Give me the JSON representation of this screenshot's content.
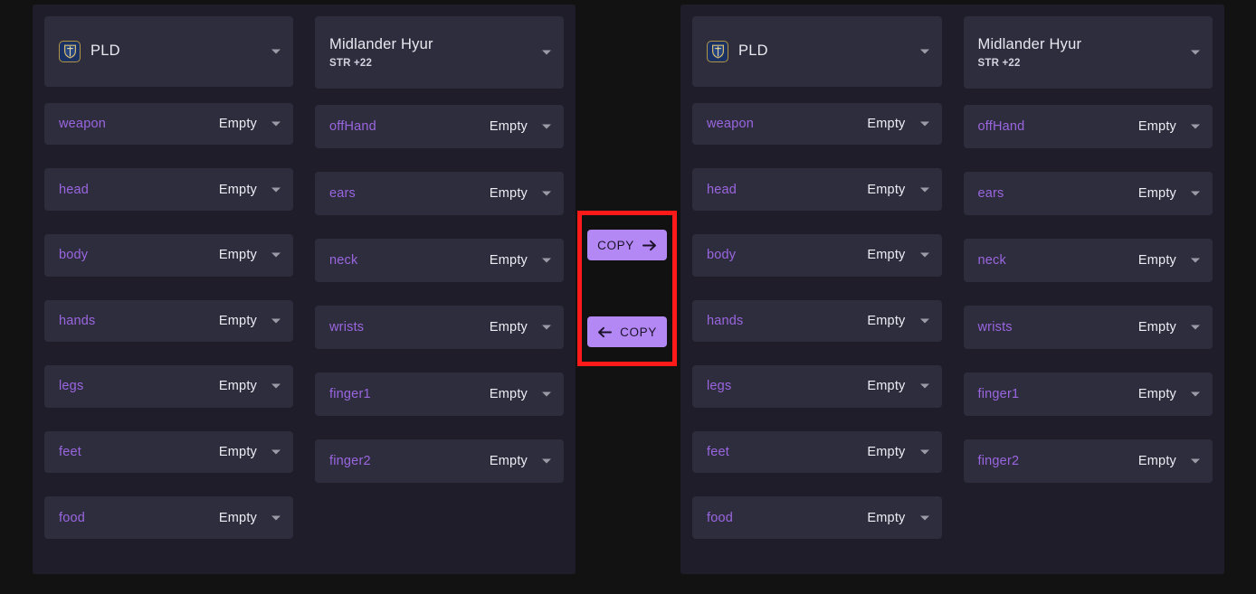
{
  "colors": {
    "background": "#121212",
    "panel": "#1e1d29",
    "card": "#2e2d3d",
    "accent_purple": "#9a66e0",
    "button_purple": "#b388f5",
    "highlight_red": "#ff1a1a",
    "text_primary": "#eceef4",
    "job_icon_bg": "#1b3161",
    "job_icon_border": "#b39445"
  },
  "panels": [
    {
      "id": "left-gearset",
      "job": {
        "icon": "paladin-job-icon",
        "label": "PLD"
      },
      "race": {
        "name": "Midlander Hyur",
        "stat": "STR +22"
      },
      "columns": [
        {
          "id": "left-column-primary",
          "slots": [
            {
              "label": "weapon",
              "value": "Empty"
            },
            {
              "label": "head",
              "value": "Empty"
            },
            {
              "label": "body",
              "value": "Empty"
            },
            {
              "label": "hands",
              "value": "Empty"
            },
            {
              "label": "legs",
              "value": "Empty"
            },
            {
              "label": "feet",
              "value": "Empty"
            },
            {
              "label": "food",
              "value": "Empty"
            }
          ]
        },
        {
          "id": "left-column-secondary",
          "slots": [
            {
              "label": "offHand",
              "value": "Empty"
            },
            {
              "label": "ears",
              "value": "Empty"
            },
            {
              "label": "neck",
              "value": "Empty"
            },
            {
              "label": "wrists",
              "value": "Empty"
            },
            {
              "label": "finger1",
              "value": "Empty"
            },
            {
              "label": "finger2",
              "value": "Empty"
            }
          ]
        }
      ]
    },
    {
      "id": "right-gearset",
      "job": {
        "icon": "paladin-job-icon",
        "label": "PLD"
      },
      "race": {
        "name": "Midlander Hyur",
        "stat": "STR +22"
      },
      "columns": [
        {
          "id": "right-column-primary",
          "slots": [
            {
              "label": "weapon",
              "value": "Empty"
            },
            {
              "label": "head",
              "value": "Empty"
            },
            {
              "label": "body",
              "value": "Empty"
            },
            {
              "label": "hands",
              "value": "Empty"
            },
            {
              "label": "legs",
              "value": "Empty"
            },
            {
              "label": "feet",
              "value": "Empty"
            },
            {
              "label": "food",
              "value": "Empty"
            }
          ]
        },
        {
          "id": "right-column-secondary",
          "slots": [
            {
              "label": "offHand",
              "value": "Empty"
            },
            {
              "label": "ears",
              "value": "Empty"
            },
            {
              "label": "neck",
              "value": "Empty"
            },
            {
              "label": "wrists",
              "value": "Empty"
            },
            {
              "label": "finger1",
              "value": "Empty"
            },
            {
              "label": "finger2",
              "value": "Empty"
            }
          ]
        }
      ]
    }
  ],
  "copy_controls": {
    "copy_right_label": "COPY",
    "copy_left_label": "COPY"
  }
}
